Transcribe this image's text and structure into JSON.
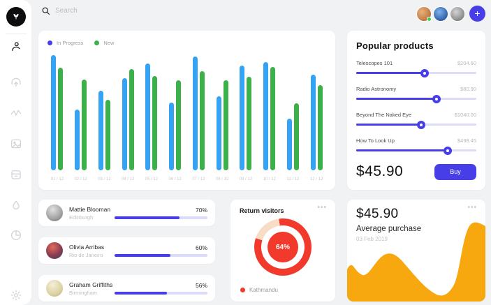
{
  "colors": {
    "accent": "#473ee8",
    "track": "#dcdcf8",
    "red": "#f23a2c",
    "peach": "#f8dcc6",
    "blue_bar": "#34a3f4",
    "green_bar": "#3cb14a",
    "orange": "#f7a80e"
  },
  "topbar": {
    "search_placeholder": "Search"
  },
  "sidebar": {
    "icons": [
      "user",
      "upload-cloud",
      "activity",
      "image",
      "calendar",
      "droplet",
      "pie-chart",
      "settings"
    ]
  },
  "chart_data": [
    {
      "type": "bar",
      "title": "",
      "categories": [
        "01 / 12",
        "02 / 12",
        "03 / 12",
        "04 / 12",
        "05 / 12",
        "06 / 12",
        "07 / 12",
        "08 / 12",
        "09 / 12",
        "10 / 12",
        "11 / 12",
        "12 / 12"
      ],
      "series": [
        {
          "name": "In Progress",
          "color": "#34a3f4",
          "dot_color": "#473ee8",
          "values": [
            100,
            53,
            69,
            80,
            93,
            59,
            99,
            64,
            91,
            94,
            45,
            83
          ]
        },
        {
          "name": "New",
          "color": "#3cb14a",
          "dot_color": "#3cb14a",
          "values": [
            89,
            79,
            61,
            88,
            82,
            78,
            86,
            78,
            81,
            90,
            58,
            74
          ]
        }
      ],
      "ylabel": "",
      "xlabel": "",
      "ylim": [
        0,
        100
      ],
      "grid": false,
      "legend_position": "top-left"
    },
    {
      "type": "pie",
      "title": "Return visitors",
      "categories": [
        "Kathmandu"
      ],
      "values": [
        64
      ],
      "center_label": "64%",
      "ring_fill_deg": [
        288,
        352
      ]
    },
    {
      "type": "area",
      "title": "Average purchase",
      "value_label": "$45.90",
      "date": "03 Feb 2019",
      "points_x_pct": [
        0,
        5,
        10,
        28,
        42,
        55,
        65,
        77,
        89,
        100
      ],
      "points_y_pct_height": [
        31,
        34,
        26,
        45,
        34,
        16,
        6,
        14,
        75,
        72
      ]
    }
  ],
  "legend": {
    "in_progress": "In Progress",
    "new": "New"
  },
  "products": {
    "title": "Popular products",
    "items": [
      {
        "name": "Telescopes 101",
        "price": "$204.60",
        "slider_pct": 57
      },
      {
        "name": "Radio Astronomy",
        "price": "$80.90",
        "slider_pct": 67
      },
      {
        "name": "Beyond The Naked Eye",
        "price": "$1040.00",
        "slider_pct": 54
      },
      {
        "name": "How To Look Up",
        "price": "$498.45",
        "slider_pct": 76
      }
    ],
    "total": "$45.90",
    "buy_label": "Buy"
  },
  "users": [
    {
      "name": "Mattie Blooman",
      "city": "Edinburgh",
      "pct": "70%",
      "pct_value": 70
    },
    {
      "name": "Olivia Arribas",
      "city": "Rio de Janeiro",
      "pct": "60%",
      "pct_value": 60
    },
    {
      "name": "Graham Griffiths",
      "city": "Birmingham",
      "pct": "56%",
      "pct_value": 56
    }
  ],
  "visitors": {
    "title": "Return visitors",
    "center": "64%",
    "legend": "Kathmandu"
  },
  "purchase": {
    "amount": "$45.90",
    "label": "Average purchase",
    "date": "03 Feb 2019"
  }
}
